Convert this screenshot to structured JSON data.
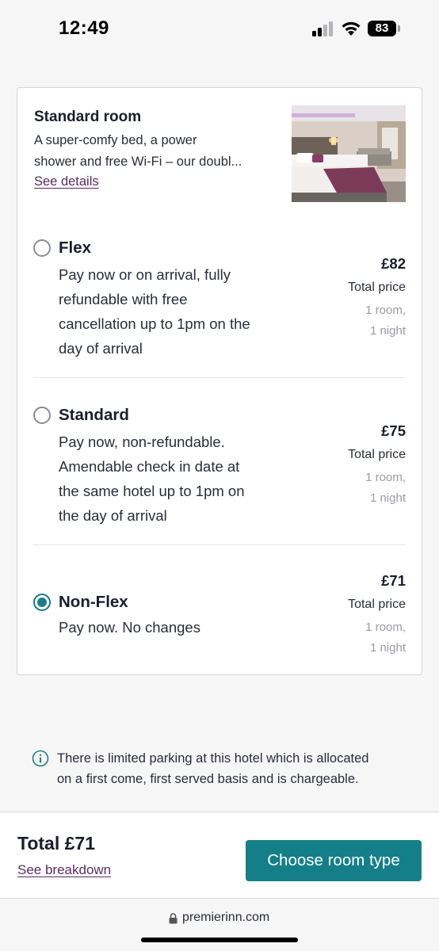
{
  "status_bar": {
    "time": "12:49",
    "battery": "83",
    "icons": [
      "cellular-signal-icon",
      "wifi-icon",
      "battery-icon"
    ]
  },
  "room": {
    "title": "Standard room",
    "description_lines": [
      "A super-comfy bed, a power",
      "shower and free Wi-Fi – our doubl..."
    ],
    "details_link": "See details"
  },
  "options": [
    {
      "title": "Flex",
      "description_lines": [
        "Pay now or on arrival, fully",
        "refundable with free",
        "cancellation up to 1pm on the",
        "day of arrival"
      ],
      "price": "£82",
      "price_label": "Total price",
      "price_sub_lines": [
        "1 room,",
        "1 night"
      ],
      "selected": false
    },
    {
      "title": "Standard",
      "description_lines": [
        "Pay now, non-refundable.",
        "Amendable check in date at",
        "the same hotel up to 1pm on",
        "the day of arrival"
      ],
      "price": "£75",
      "price_label": "Total price",
      "price_sub_lines": [
        "1 room,",
        "1 night"
      ],
      "selected": false
    },
    {
      "title": "Non-Flex",
      "description_lines": [
        "Pay now. No changes"
      ],
      "price": "£71",
      "price_label": "Total price",
      "price_sub_lines": [
        "1 room,",
        "1 night"
      ],
      "selected": true
    }
  ],
  "info": {
    "icon": "info-icon",
    "lines": [
      "There is limited parking at this hotel which is allocated",
      "on a first come, first served basis and is chargeable."
    ]
  },
  "footer": {
    "total": "Total £71",
    "breakdown_link": "See breakdown",
    "cta": "Choose room type"
  },
  "browser": {
    "url": "premierinn.com"
  },
  "colors": {
    "accent": "#157f89",
    "link": "#5b2a63",
    "radio_selected": "#1a7d8a"
  }
}
